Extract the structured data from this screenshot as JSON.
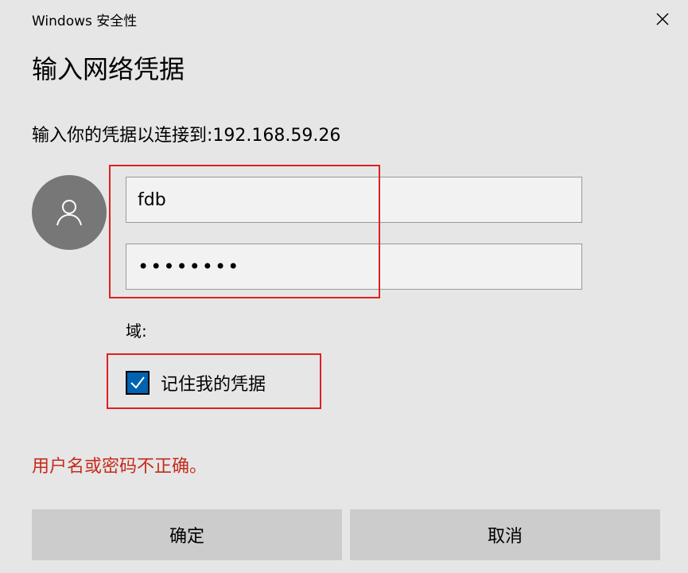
{
  "window": {
    "title": "Windows 安全性",
    "close_icon": "close-icon"
  },
  "dialog": {
    "heading": "输入网络凭据",
    "prompt": "输入你的凭据以连接到:192.168.59.26",
    "avatar_icon": "user-icon",
    "username_value": "fdb",
    "password_value": "••••••••",
    "domain_label": "域:",
    "remember": {
      "label": "记住我的凭据",
      "checked": true
    },
    "error_message": "用户名或密码不正确。",
    "ok_label": "确定",
    "cancel_label": "取消"
  },
  "colors": {
    "background": "#e6e6e6",
    "highlight_border": "#e02020",
    "error": "#c42b1c",
    "checkbox_fill": "#0063b1",
    "button": "#cccccc",
    "avatar": "#777777"
  }
}
